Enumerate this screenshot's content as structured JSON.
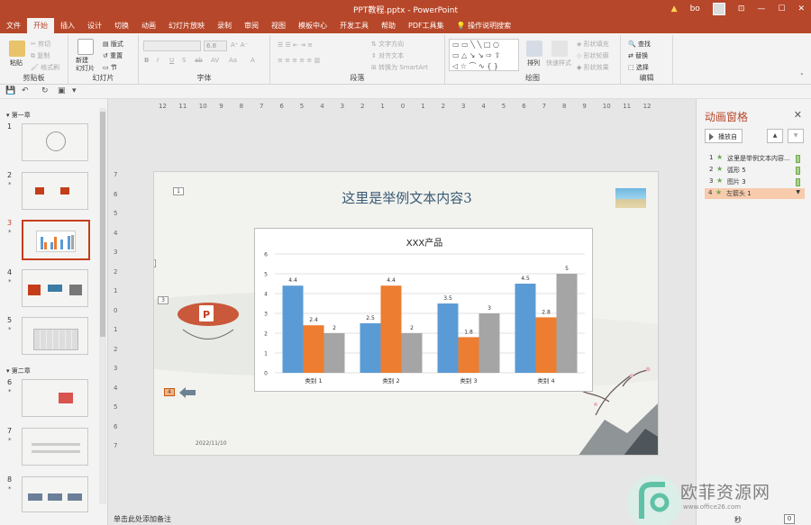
{
  "window": {
    "title": "PPT教程.pptx  -  PowerPoint",
    "user": "bo",
    "warn_icon": "warning-icon"
  },
  "menu": [
    "文件",
    "开始",
    "插入",
    "设计",
    "切换",
    "动画",
    "幻灯片放映",
    "录制",
    "审阅",
    "视图",
    "模板中心",
    "开发工具",
    "帮助",
    "PDF工具集",
    "操作说明搜索"
  ],
  "ribbon": {
    "clipboard": {
      "label": "剪贴板",
      "paste": "粘贴",
      "cut": "剪切",
      "copy": "复制",
      "format_painter": "格式刷"
    },
    "slides": {
      "label": "幻灯片",
      "new_slide": "新建\n幻灯片",
      "layout": "版式",
      "reset": "重置",
      "section": "节"
    },
    "font": {
      "label": "字体",
      "size": "6.8"
    },
    "paragraph": {
      "label": "段落",
      "text_direction": "文字方向",
      "align_text": "对齐文本",
      "smartart": "转换为 SmartArt"
    },
    "drawing": {
      "label": "绘图",
      "arrange": "排列",
      "quick_styles": "快速样式",
      "fill": "形状填充",
      "outline": "形状轮廓",
      "effects": "形状效果"
    },
    "editing": {
      "label": "编辑",
      "find": "查找",
      "replace": "替换",
      "select": "选择"
    }
  },
  "sections": {
    "ch1": "第一章",
    "ch2": "第二章"
  },
  "thumbs": [
    {
      "num": "1",
      "star": ""
    },
    {
      "num": "2",
      "star": "*"
    },
    {
      "num": "3",
      "star": "*"
    },
    {
      "num": "4",
      "star": "*"
    },
    {
      "num": "5",
      "star": "*"
    },
    {
      "num": "6",
      "star": "*"
    },
    {
      "num": "7",
      "star": "*"
    },
    {
      "num": "8",
      "star": "*"
    }
  ],
  "slide": {
    "title": "这里是举例文本内容3",
    "date": "2022/11/10",
    "tags": [
      "1",
      "2",
      "3",
      "4"
    ]
  },
  "chart_data": {
    "type": "bar",
    "title": "XXX产品",
    "categories": [
      "类别 1",
      "类别 2",
      "类别 3",
      "类别 4"
    ],
    "series": [
      {
        "values": [
          4.4,
          2.5,
          3.5,
          4.5
        ],
        "color": "#5b9bd5"
      },
      {
        "values": [
          2.4,
          4.4,
          1.8,
          2.8
        ],
        "color": "#ed7d31"
      },
      {
        "values": [
          2,
          2,
          3,
          5
        ],
        "color": "#a5a5a5"
      }
    ],
    "ylim": [
      0,
      6
    ],
    "yticks": [
      0,
      1,
      2,
      3,
      4,
      5,
      6
    ],
    "grid": true
  },
  "anim_pane": {
    "title": "动画窗格",
    "play_button": "播放自",
    "items": [
      {
        "num": "1",
        "label": "这里是举例文本内容..."
      },
      {
        "num": "2",
        "label": "弧形 5"
      },
      {
        "num": "3",
        "label": "图片 3"
      },
      {
        "num": "4",
        "label": "左箭头 1"
      }
    ]
  },
  "status": {
    "notes": "单击此处添加备注",
    "seconds": "秒",
    "counter": "0"
  },
  "watermark": {
    "text": "欧菲资源网",
    "url": "www.office26.com"
  },
  "ruler_h": [
    "12",
    "11",
    "10",
    "9",
    "8",
    "7",
    "6",
    "5",
    "4",
    "3",
    "2",
    "1",
    "0",
    "1",
    "2",
    "3",
    "4",
    "5",
    "6",
    "7",
    "8",
    "9",
    "10",
    "11",
    "12"
  ],
  "ruler_v": [
    "7",
    "6",
    "5",
    "4",
    "3",
    "2",
    "1",
    "0",
    "1",
    "2",
    "3",
    "4",
    "5",
    "6",
    "7"
  ]
}
